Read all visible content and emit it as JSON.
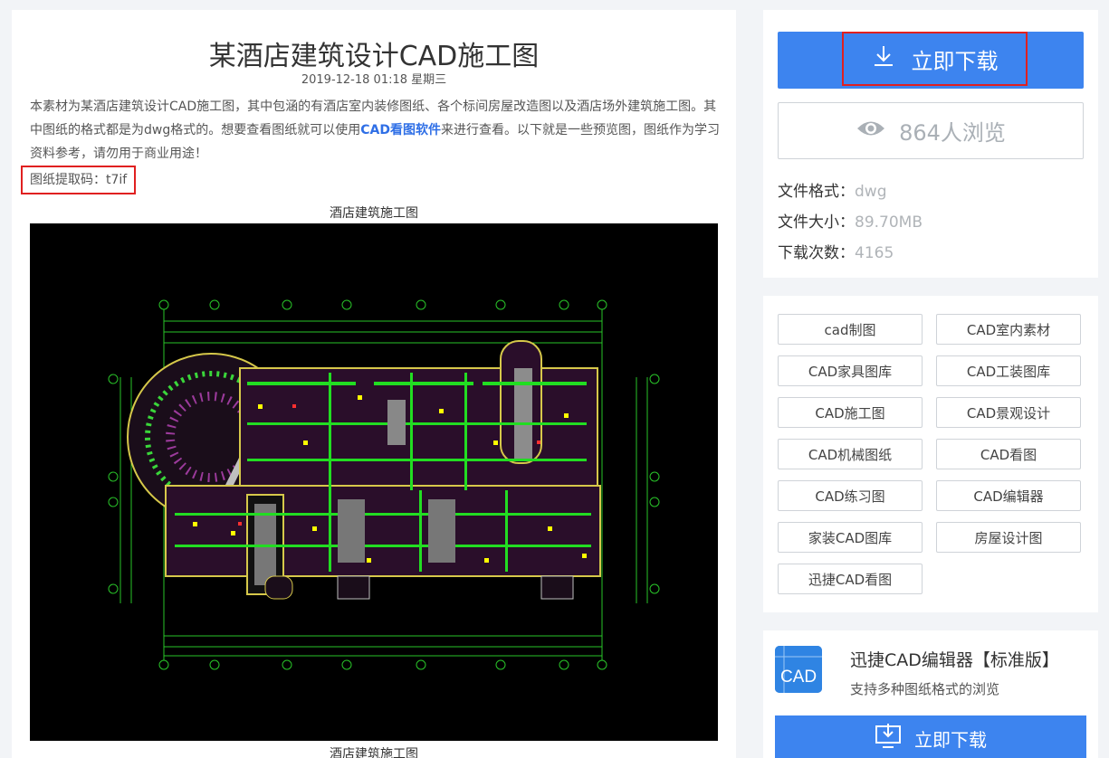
{
  "article": {
    "title": "某酒店建筑设计CAD施工图",
    "date": "2019-12-18 01:18 星期三",
    "intro_part1": "本素材为某酒店建筑设计CAD施工图，其中包涵的有酒店室内装修图纸、各个标间房屋改造图以及酒店场外建筑施工图。其中图纸的格式都是为dwg格式的。想要查看图纸就可以使用",
    "intro_link": "CAD看图软件",
    "intro_part2": "来进行查看。以下就是一些预览图，图纸作为学习资料参考，请勿用于商业用途！",
    "code_label": "图纸提取码：",
    "code_value": "t7if",
    "image_caption_top": "酒店建筑施工图",
    "image_caption_bottom": "酒店建筑施工图"
  },
  "sidebar": {
    "download_label": "立即下载",
    "views_count": "864",
    "views_suffix": "人浏览",
    "file_format_label": "文件格式：",
    "file_format": "dwg",
    "file_size_label": "文件大小：",
    "file_size": "89.70MB",
    "download_count_label": "下载次数：",
    "download_count": "4165",
    "tags": [
      "cad制图",
      "CAD室内素材",
      "CAD家具图库",
      "CAD工装图库",
      "CAD施工图",
      "CAD景观设计",
      "CAD机械图纸",
      "CAD看图",
      "CAD练习图",
      "CAD编辑器",
      "家装CAD图库",
      "房屋设计图",
      "迅捷CAD看图"
    ],
    "app": {
      "name": "迅捷CAD编辑器【标准版】",
      "desc": "支持多种图纸格式的浏览",
      "icon_text": "CAD",
      "download_label": "立即下载"
    }
  },
  "colors": {
    "accent": "#3d84ef",
    "highlight": "#e02020",
    "link": "#2f6fe6"
  },
  "icons": {
    "download": "download-arrow-icon",
    "views": "eye-icon",
    "app": "cad-app-icon",
    "app_download": "monitor-download-icon"
  }
}
